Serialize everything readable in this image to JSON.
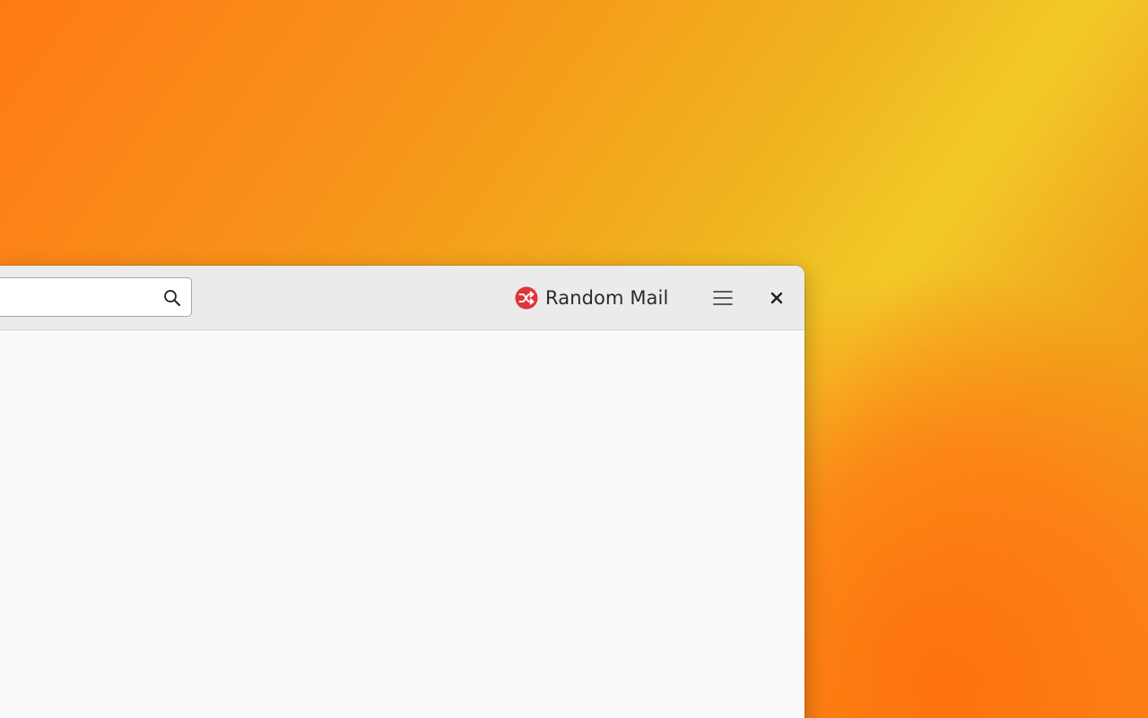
{
  "window": {
    "title": "Random Mail",
    "logo_icon": "shuffle-icon",
    "accent_color": "#e0353a"
  },
  "search": {
    "value": "",
    "placeholder": "",
    "icon": "search-icon"
  },
  "header_buttons": {
    "menu_icon": "hamburger-menu-icon",
    "close_icon": "close-icon"
  }
}
